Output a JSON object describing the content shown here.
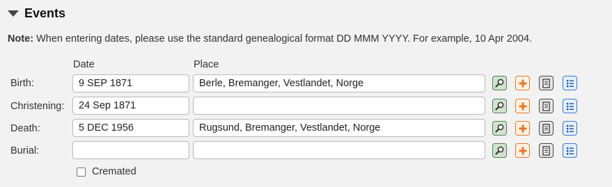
{
  "section": {
    "title": "Events"
  },
  "note": {
    "label": "Note:",
    "text": " When entering dates, please use the standard genealogical format DD MMM YYYY. For example, 10 Apr 2004."
  },
  "columns": {
    "date": "Date",
    "place": "Place"
  },
  "events": [
    {
      "label": "Birth:",
      "date": "9 SEP 1871",
      "place": "Berle, Bremanger, Vestlandet, Norge"
    },
    {
      "label": "Christening:",
      "date": "24 Sep 1871",
      "place": ""
    },
    {
      "label": "Death:",
      "date": "5 DEC 1956",
      "place": "Rugsund, Bremanger, Vestlandet, Norge"
    },
    {
      "label": "Burial:",
      "date": "",
      "place": ""
    }
  ],
  "cremated": {
    "label": "Cremated",
    "checked": false
  },
  "icons": {
    "search": "search-place-icon",
    "add": "add-place-icon",
    "source": "source-icon",
    "notes": "notes-list-icon"
  },
  "colors": {
    "search": "#5a7d5a",
    "add": "#e07a2a",
    "source": "#444444",
    "list": "#3c78c8"
  }
}
